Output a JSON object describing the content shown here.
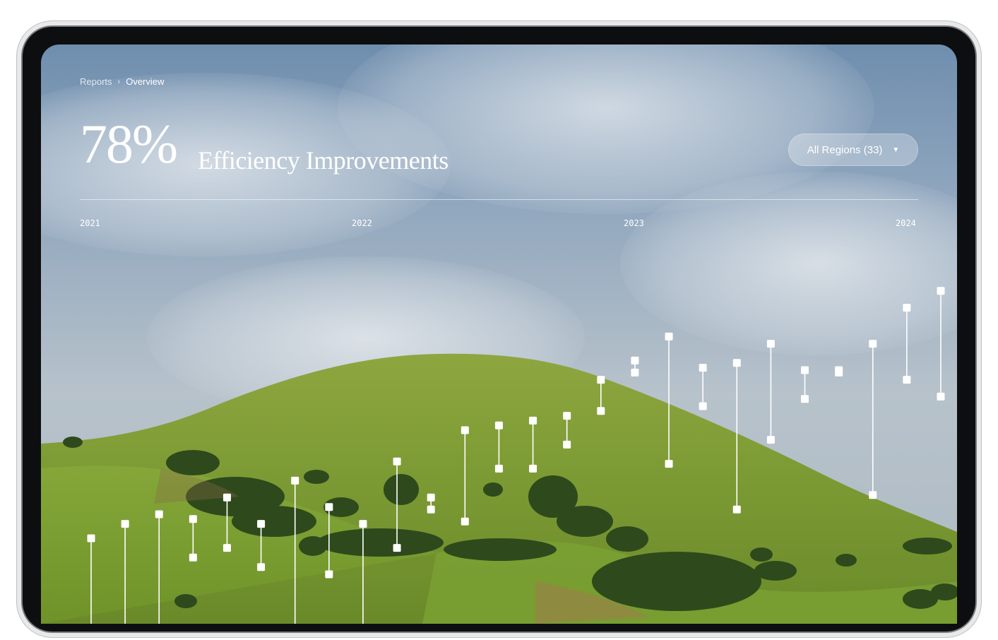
{
  "breadcrumb": {
    "parent": "Reports",
    "separator": "›",
    "current": "Overview"
  },
  "headline": {
    "value": "78%",
    "title": "Efficiency Improvements"
  },
  "region_filter": {
    "label": "All Regions (33)",
    "caret": "▼"
  },
  "timeline": {
    "years": [
      "2021",
      "2022",
      "2023",
      "2024"
    ]
  },
  "colors": {
    "accent": "#ffffff"
  },
  "icons": {
    "separator": "chevron-right-icon",
    "caret": "caret-down-icon"
  },
  "chart_data": {
    "type": "range",
    "x_axis": {
      "ticks": [
        "2021",
        "2022",
        "2023",
        "2024"
      ]
    },
    "series": [
      {
        "values": [
          [
            0,
            4.0
          ],
          [
            1,
            4.6
          ],
          [
            2,
            5.0
          ],
          [
            3,
            4.8
          ],
          [
            4,
            5.7
          ],
          [
            5,
            4.6
          ],
          [
            6,
            6.4
          ],
          [
            7,
            5.3
          ],
          [
            8,
            4.6
          ],
          [
            9,
            7.2
          ],
          [
            10,
            5.7
          ],
          [
            11,
            8.5
          ],
          [
            12,
            8.7
          ],
          [
            13,
            8.9
          ],
          [
            14,
            9.1
          ],
          [
            15,
            10.6
          ],
          [
            16,
            11.4
          ],
          [
            17,
            12.4
          ],
          [
            18,
            11.1
          ],
          [
            19,
            11.3
          ],
          [
            20,
            12.1
          ],
          [
            21,
            11.0
          ],
          [
            22,
            11.0
          ],
          [
            23,
            12.1
          ],
          [
            24,
            13.6
          ],
          [
            25,
            14.3
          ]
        ]
      },
      {
        "values": [
          [
            0,
            0
          ],
          [
            1,
            0
          ],
          [
            2,
            0
          ],
          [
            3,
            3.2
          ],
          [
            4,
            3.6
          ],
          [
            5,
            2.8
          ],
          [
            6,
            0
          ],
          [
            7,
            2.5
          ],
          [
            8,
            0
          ],
          [
            9,
            3.6
          ],
          [
            10,
            5.2
          ],
          [
            11,
            4.7
          ],
          [
            12,
            6.9
          ],
          [
            13,
            6.9
          ],
          [
            14,
            7.9
          ],
          [
            15,
            9.3
          ],
          [
            16,
            10.9
          ],
          [
            17,
            7.1
          ],
          [
            18,
            9.5
          ],
          [
            19,
            5.2
          ],
          [
            20,
            8.1
          ],
          [
            21,
            9.8
          ],
          [
            22,
            10.9
          ],
          [
            23,
            5.8
          ],
          [
            24,
            10.6
          ],
          [
            25,
            9.9
          ]
        ]
      }
    ],
    "range_lows": [
      0,
      0,
      0,
      3.2,
      3.6,
      2.8,
      0,
      2.5,
      0,
      3.6,
      5.2,
      4.7,
      6.9,
      6.9,
      7.9,
      9.3,
      10.9,
      7.1,
      9.5,
      5.2,
      8.1,
      9.8,
      10.9,
      5.8,
      10.6,
      9.9
    ],
    "range_highs": [
      4.0,
      4.6,
      5.0,
      4.8,
      5.7,
      4.6,
      6.4,
      5.3,
      4.6,
      7.2,
      5.7,
      8.5,
      8.7,
      8.9,
      9.1,
      10.6,
      11.4,
      12.4,
      11.1,
      11.3,
      12.1,
      11.0,
      11.0,
      12.1,
      13.6,
      14.3
    ],
    "ylim": [
      0,
      15
    ],
    "grid": false,
    "legend": "none"
  }
}
